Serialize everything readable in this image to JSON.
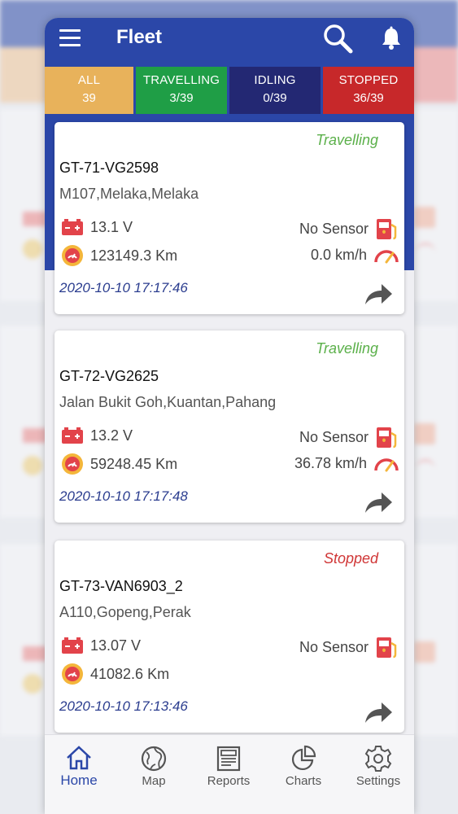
{
  "header": {
    "title": "Fleet"
  },
  "tabs": [
    {
      "label": "ALL",
      "count": "39",
      "color": "#e8b25b"
    },
    {
      "label": "TRAVELLING",
      "count": "3/39",
      "color": "#1f9e46"
    },
    {
      "label": "IDLING",
      "count": "0/39",
      "color": "#232873"
    },
    {
      "label": "STOPPED",
      "count": "36/39",
      "color": "#c7282a"
    }
  ],
  "vehicles": [
    {
      "status": "Travelling",
      "id": "GT-71-VG2598",
      "location": "M107,Melaka,Melaka",
      "battery": "13.1 V",
      "fuel": "No Sensor",
      "odometer": "123149.3 Km",
      "speed": "0.0 km/h",
      "time": "2020-10-10 17:17:46"
    },
    {
      "status": "Travelling",
      "id": "GT-72-VG2625",
      "location": "Jalan Bukit Goh,Kuantan,Pahang",
      "battery": "13.2 V",
      "fuel": "No Sensor",
      "odometer": "59248.45 Km",
      "speed": "36.78 km/h",
      "time": "2020-10-10 17:17:48"
    },
    {
      "status": "Stopped",
      "id": "GT-73-VAN6903_2",
      "location": "A110,Gopeng,Perak",
      "battery": "13.07 V",
      "fuel": "No Sensor",
      "odometer": "41082.6 Km",
      "speed": "",
      "time": "2020-10-10 17:13:46"
    }
  ],
  "nav": [
    {
      "label": "Home",
      "icon": "home-icon",
      "active": true
    },
    {
      "label": "Map",
      "icon": "globe-icon"
    },
    {
      "label": "Reports",
      "icon": "reports-icon"
    },
    {
      "label": "Charts",
      "icon": "pie-chart-icon"
    },
    {
      "label": "Settings",
      "icon": "gear-icon"
    }
  ],
  "colors": {
    "header": "#2b47a8",
    "travelling": "#5bb04a",
    "stopped": "#d03636",
    "time": "#2b3d8f"
  }
}
